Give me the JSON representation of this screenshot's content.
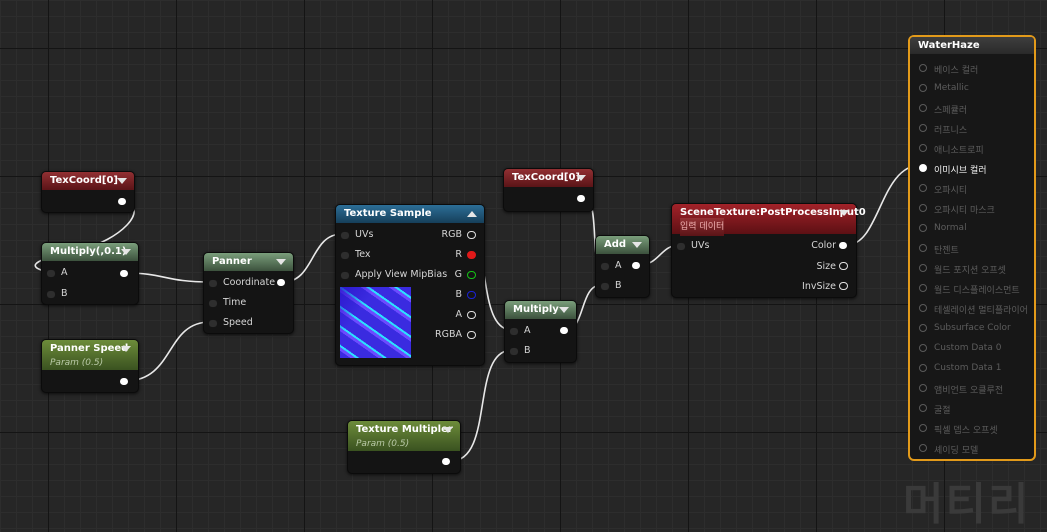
{
  "nodes": {
    "texcoord1": {
      "title": "TexCoord[0]"
    },
    "multiply1": {
      "title": "Multiply(,0.1)",
      "inputs": [
        "A",
        "B"
      ]
    },
    "panner_speed": {
      "title": "Panner Speed",
      "subtitle": "Param (0.5)"
    },
    "panner": {
      "title": "Panner",
      "inputs": [
        "Coordinate",
        "Time",
        "Speed"
      ]
    },
    "texture_sample": {
      "title": "Texture Sample",
      "inputs": [
        "UVs",
        "Tex",
        "Apply View MipBias"
      ],
      "outputs": [
        "RGB",
        "R",
        "G",
        "B",
        "A",
        "RGBA"
      ]
    },
    "texture_multiplier": {
      "title": "Texture Multipler",
      "subtitle": "Param (0.5)"
    },
    "texcoord2": {
      "title": "TexCoord[0]"
    },
    "multiply2": {
      "title": "Multiply",
      "inputs": [
        "A",
        "B"
      ]
    },
    "add": {
      "title": "Add",
      "inputs": [
        "A",
        "B"
      ]
    },
    "scene_texture": {
      "title": "SceneTexture:PostProcessInput0",
      "subtitle": "입력 데이터",
      "inputs": [
        "UVs"
      ],
      "outputs": [
        "Color",
        "Size",
        "InvSize"
      ]
    },
    "water_haze": {
      "title": "WaterHaze",
      "inputs": [
        "베이스 컬러",
        "Metallic",
        "스페큘러",
        "러프니스",
        "애니소트로피",
        "이미시브 컬러",
        "오파시티",
        "오파시티 마스크",
        "Normal",
        "탄젠트",
        "월드 포지션 오프셋",
        "월드 디스플레이스먼트",
        "테셀레이션 멀티플라이어",
        "Subsurface Color",
        "Custom Data 0",
        "Custom Data 1",
        "앰비언트 오클루전",
        "굴절",
        "픽셀 뎁스 오프셋",
        "셰이딩 모델"
      ],
      "active_input": "이미시브 컬러"
    }
  },
  "watermark": "머티리",
  "colors": {
    "selection": "#e29a1a",
    "param": "#5a7a2e",
    "texture": "#1e5a80",
    "scene": "#8d1a20"
  }
}
